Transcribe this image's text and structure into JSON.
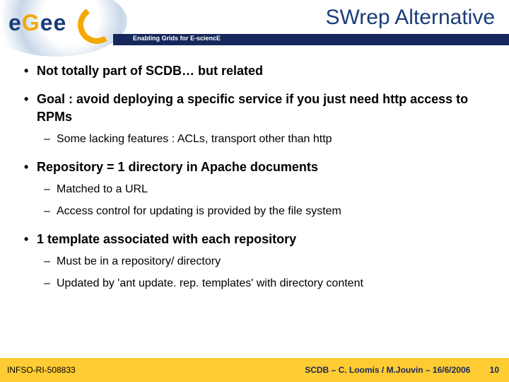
{
  "header": {
    "title": "SWrep Alternative",
    "tagline": "Enabling Grids for E-sciencE",
    "logo_letters": [
      "e",
      "G",
      "e",
      "e"
    ]
  },
  "bullets": [
    {
      "text": "Not totally part of SCDB… but related",
      "sub": []
    },
    {
      "text": "Goal : avoid deploying a specific service if you just need http access to RPMs",
      "sub": [
        "Some lacking features : ACLs, transport other than http"
      ]
    },
    {
      "text": "Repository = 1 directory in Apache documents",
      "sub": [
        "Matched to a URL",
        "Access control for updating is provided by the file system"
      ]
    },
    {
      "text": "1 template associated with each repository",
      "sub": [
        "Must be in a repository/ directory",
        "Updated by 'ant update. rep. templates' with directory content"
      ]
    }
  ],
  "footer": {
    "left": "INFSO-RI-508833",
    "right": "SCDB – C. Loomis / M.Jouvin – 16/6/2006",
    "page": "10"
  }
}
